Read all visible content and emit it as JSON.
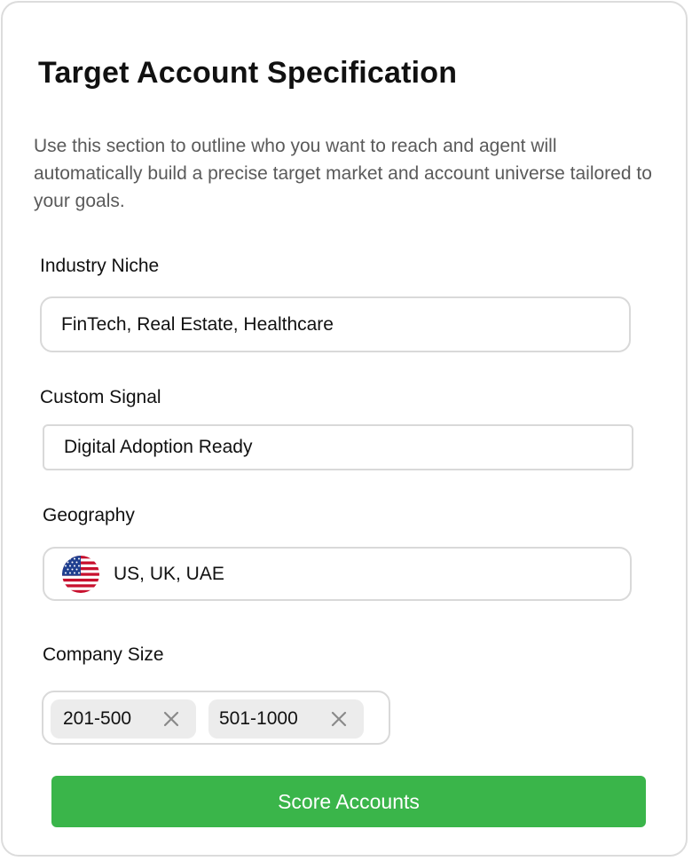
{
  "header": {
    "title": "Target Account Specification",
    "description": "Use this section to outline who you want to reach and agent will automatically build a precise target market and account universe tailored to your goals."
  },
  "fields": {
    "industry": {
      "label": "Industry Niche",
      "value": "FinTech, Real Estate, Healthcare"
    },
    "signal": {
      "label": "Custom Signal",
      "value": "Digital Adoption Ready"
    },
    "geography": {
      "label": "Geography",
      "value": "US, UK, UAE",
      "icon": "us-flag-icon"
    },
    "company_size": {
      "label": "Company Size",
      "chips": [
        {
          "label": "201-500",
          "remove_icon": "close-icon"
        },
        {
          "label": "501-1000",
          "remove_icon": "close-icon"
        }
      ]
    }
  },
  "actions": {
    "submit_label": "Score Accounts"
  },
  "colors": {
    "accent": "#3ab54a",
    "border": "#d9d9d9",
    "chip_bg": "#ececec",
    "muted_text": "#5a5a5a"
  }
}
